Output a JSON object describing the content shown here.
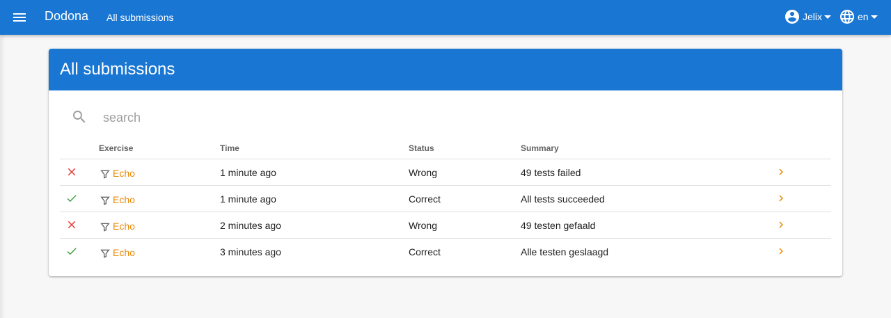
{
  "nav": {
    "brand": "Dodona",
    "breadcrumb": "All submissions",
    "user": "Jelix",
    "language": "en"
  },
  "page": {
    "title": "All submissions"
  },
  "search": {
    "placeholder": "search",
    "value": ""
  },
  "table": {
    "headers": [
      "Exercise",
      "Time",
      "Status",
      "Summary"
    ],
    "rows": [
      {
        "result": "wrong",
        "exercise": "Echo",
        "time": "1 minute ago",
        "status": "Wrong",
        "summary": "49 tests failed"
      },
      {
        "result": "correct",
        "exercise": "Echo",
        "time": "1 minute ago",
        "status": "Correct",
        "summary": "All tests succeeded"
      },
      {
        "result": "wrong",
        "exercise": "Echo",
        "time": "2 minutes ago",
        "status": "Wrong",
        "summary": "49 testen gefaald"
      },
      {
        "result": "correct",
        "exercise": "Echo",
        "time": "3 minutes ago",
        "status": "Correct",
        "summary": "Alle testen geslaagd"
      }
    ]
  },
  "colors": {
    "primary": "#1976d2",
    "accent": "#e88b0a",
    "correct": "#43a047",
    "wrong": "#e53935"
  }
}
